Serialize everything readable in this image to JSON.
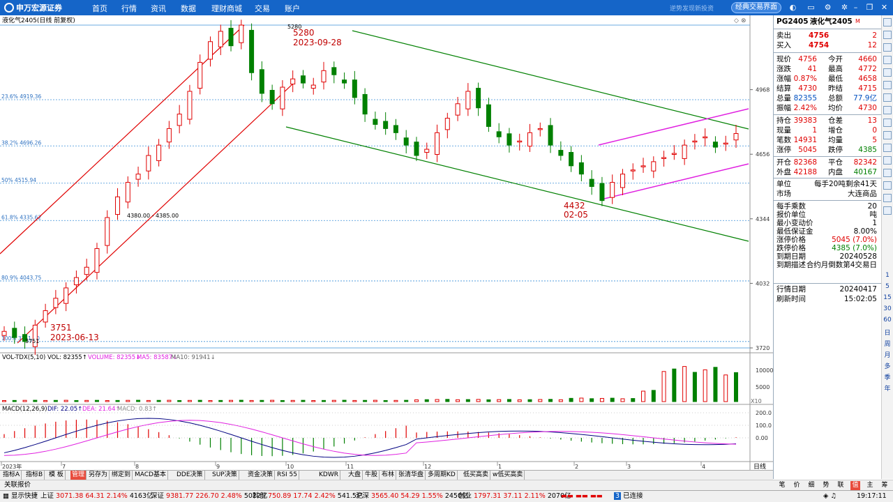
{
  "top": {
    "logo": "申万宏源证券",
    "nav": [
      "首页",
      "行情",
      "资讯",
      "数据",
      "理财商城",
      "交易",
      "账户"
    ],
    "tagline": "逆势发现新投资",
    "classic_btn": "经典交易界面",
    "icons": [
      "skin-icon",
      "message-icon",
      "settings-icon",
      "minimize-icon",
      "restore-icon",
      "close-icon"
    ]
  },
  "chart": {
    "title": "液化气2405(日线 前复权)",
    "volume_indicator": {
      "name": "VOL-TDX(5,10)",
      "vol": "VOL: 82355↑",
      "volume": "VOLUME: 82355↓",
      "ma5": "MA5: 83587↓",
      "ma10": "MA10: 91941↓"
    },
    "macd_indicator": {
      "name": "MACD(12,26,9)",
      "dif": "DIF: 22.05↑",
      "dea": "DEA: 21.64↑",
      "macd": "MACD: 0.83↑"
    },
    "price_axis": [
      "4968",
      "4656",
      "4344",
      "4032",
      "3720"
    ],
    "volume_axis": [
      "10000",
      "5000"
    ],
    "volume_unit": "X10",
    "macd_axis": [
      "200.0",
      "100.0",
      "0.00"
    ],
    "fib_labels": [
      "23.6% 4919.36",
      "38.2% 4696.26",
      "50% 4515.94",
      "61.8% 4335.62",
      "80.9% 4043.75",
      "100% 3751.00"
    ],
    "time_labels": [
      "2023年",
      "7",
      "8",
      "9",
      "10",
      "11",
      "12",
      "1",
      "2",
      "3",
      "4"
    ],
    "period_label": "日线",
    "annotations": {
      "high_price": "5280",
      "high_date": "2023-09-28",
      "high_marker": "5280",
      "low_price": "3751",
      "low_date": "2023-06-13",
      "low_marker": "3751",
      "mid_low_price": "4432",
      "mid_low_date": "02-05",
      "gap_label": "4380.00 - 4385.00"
    },
    "colors": {
      "up": "#e00000",
      "down": "#008000",
      "channel_up": "#e00000",
      "channel_down": "#008000",
      "channel_pink": "#e020e0",
      "fib": "#3a8fd8",
      "dif": "#000080",
      "dea": "#e020e0"
    }
  },
  "tabs": [
    "指标A",
    "指标B",
    "模 板",
    "管理",
    "另存为",
    "绑定到",
    "MACD基本",
    "DDE决策",
    "SUP决策",
    "资金决策",
    "RSI 55",
    "KDWR",
    "大盘",
    "牛股",
    "布林",
    "张清华盘",
    "多周期KD",
    "低买高卖",
    "w低买高卖"
  ],
  "related": "关联报价",
  "right_tabs": [
    "笔",
    "价",
    "细",
    "势",
    "联",
    "值",
    "主",
    "筹"
  ],
  "quote": {
    "code": "PG2405",
    "name": "液化气2405",
    "flag": "M",
    "sell": {
      "label": "卖出",
      "price": "4756",
      "vol": "2"
    },
    "buy": {
      "label": "买入",
      "price": "4754",
      "vol": "12"
    },
    "rows": [
      [
        "现价",
        "4756",
        "今开",
        "4660"
      ],
      [
        "涨跌",
        "41",
        "最高",
        "4772"
      ],
      [
        "涨幅",
        "0.87%",
        "最低",
        "4658"
      ],
      [
        "结算",
        "4730",
        "昨结",
        "4715"
      ],
      [
        "总量",
        "82355",
        "总额",
        "77.9亿"
      ],
      [
        "振幅",
        "2.42%",
        "均价",
        "4730"
      ]
    ],
    "rows2": [
      [
        "持仓",
        "39383",
        "仓差",
        "13"
      ],
      [
        "现量",
        "1",
        "增仓",
        "0"
      ],
      [
        "笔数",
        "14931",
        "均量",
        "5"
      ],
      [
        "涨停",
        "5045",
        "跌停",
        "4385"
      ]
    ],
    "rows3": [
      [
        "开仓",
        "82368",
        "平仓",
        "82342"
      ],
      [
        "外盘",
        "42188",
        "内盘",
        "40167"
      ]
    ],
    "unit": {
      "label": "单位",
      "value": "每手20吨",
      "remain": "剩余41天"
    },
    "market": {
      "label": "市场",
      "value": "大连商品"
    },
    "specs": [
      [
        "每手乘数",
        "20"
      ],
      [
        "报价单位",
        "吨"
      ],
      [
        "最小变动价",
        "1"
      ],
      [
        "最低保证金",
        "8.00%"
      ],
      [
        "涨停价格",
        "5045 (7.0%)"
      ],
      [
        "跌停价格",
        "4385 (7.0%)"
      ],
      [
        "到期日期",
        "20240528"
      ],
      [
        "到期描述",
        "合约月倒数第4交易日"
      ]
    ],
    "date": [
      "行情日期",
      "20240417"
    ],
    "refresh": [
      "刷新时间",
      "15:02:05"
    ]
  },
  "right_toolbar": [
    "1",
    "5",
    "15",
    "30",
    "60",
    "日",
    "周",
    "月",
    "多",
    "季",
    "年"
  ],
  "status": {
    "show_quote": "显示快捷",
    "sh": {
      "name": "上证",
      "val": "3071.38",
      "chg": "64.31",
      "pct": "2.14%",
      "amt": "4163亿"
    },
    "sz": {
      "name": "深证",
      "val": "9381.77",
      "chg": "226.70",
      "pct": "2.48%",
      "amt": "5022亿"
    },
    "kc": {
      "name": "科创",
      "val": "750.89",
      "chg": "17.74",
      "pct": "2.42%",
      "amt": "541.5亿"
    },
    "hs": {
      "name": "沪深",
      "val": "3565.40",
      "chg": "54.29",
      "pct": "1.55%",
      "amt": "2450亿"
    },
    "cy": {
      "name": "创业",
      "val": "1797.31",
      "chg": "37.11",
      "pct": "2.11%",
      "amt": "2070亿"
    },
    "conn": "已连接",
    "time": "19:17:11"
  },
  "chart_data": {
    "type": "candlestick",
    "title": "液化气2405(日线 前复权)",
    "price_range": [
      3720,
      5280
    ],
    "series": [
      {
        "name": "ohlc_close_approx",
        "values": [
          3800,
          3770,
          3751,
          3830,
          3900,
          3960,
          4010,
          4060,
          4110,
          4200,
          4350,
          4450,
          4520,
          4560,
          4650,
          4700,
          4780,
          4850,
          4960,
          5100,
          5200,
          5250,
          5180,
          5280,
          5050,
          4950,
          4900,
          4980,
          5020,
          5000,
          4990,
          5060,
          5040,
          5000,
          4930,
          4850,
          4800,
          4780,
          4760,
          4700,
          4650,
          4680,
          4760,
          4830,
          4900,
          4960,
          4880,
          4790,
          4740,
          4700,
          4720,
          4760,
          4780,
          4700,
          4650,
          4600,
          4560,
          4500,
          4432,
          4520,
          4560,
          4580,
          4600,
          4620,
          4640,
          4660,
          4700,
          4720,
          4740,
          4690,
          4710,
          4756
        ]
      }
    ]
  }
}
